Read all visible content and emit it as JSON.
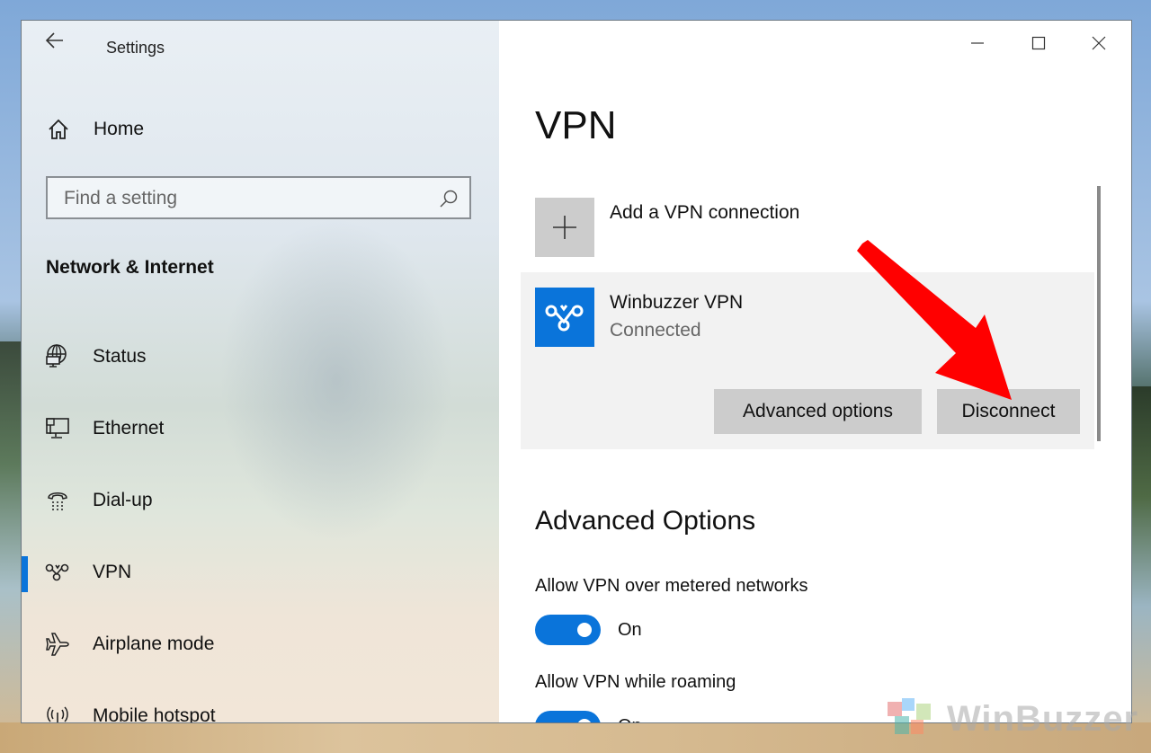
{
  "window": {
    "app_title": "Settings",
    "controls": {
      "minimize": "minimize-icon",
      "maximize": "maximize-icon",
      "close": "close-icon"
    }
  },
  "sidebar": {
    "back_icon": "back-arrow-icon",
    "home": {
      "label": "Home",
      "icon": "home-icon"
    },
    "search": {
      "placeholder": "Find a setting",
      "value": "",
      "icon": "search-icon"
    },
    "section_title": "Network & Internet",
    "items": [
      {
        "label": "Status",
        "icon": "globe-monitor-icon",
        "active": false
      },
      {
        "label": "Ethernet",
        "icon": "ethernet-icon",
        "active": false
      },
      {
        "label": "Dial-up",
        "icon": "phone-icon",
        "active": false
      },
      {
        "label": "VPN",
        "icon": "vpn-icon",
        "active": true
      },
      {
        "label": "Airplane mode",
        "icon": "airplane-icon",
        "active": false
      },
      {
        "label": "Mobile hotspot",
        "icon": "hotspot-icon",
        "active": false
      }
    ]
  },
  "main": {
    "page_title": "VPN",
    "add_connection": {
      "label": "Add a VPN connection",
      "icon": "plus-icon"
    },
    "connection": {
      "name": "Winbuzzer VPN",
      "status": "Connected",
      "icon": "vpn-icon",
      "advanced_options_label": "Advanced options",
      "disconnect_label": "Disconnect"
    },
    "advanced": {
      "title": "Advanced Options",
      "options": [
        {
          "label": "Allow VPN over metered networks",
          "state_label": "On",
          "on": true
        },
        {
          "label": "Allow VPN while roaming",
          "state_label": "On",
          "on": true
        }
      ]
    }
  },
  "annotation": {
    "arrow_color": "#ff0000",
    "target": "Disconnect"
  },
  "watermark": {
    "text": "WinBuzzer"
  },
  "colors": {
    "accent": "#0a74da",
    "button_bg": "#cccccc",
    "card_bg": "#f2f2f2"
  }
}
